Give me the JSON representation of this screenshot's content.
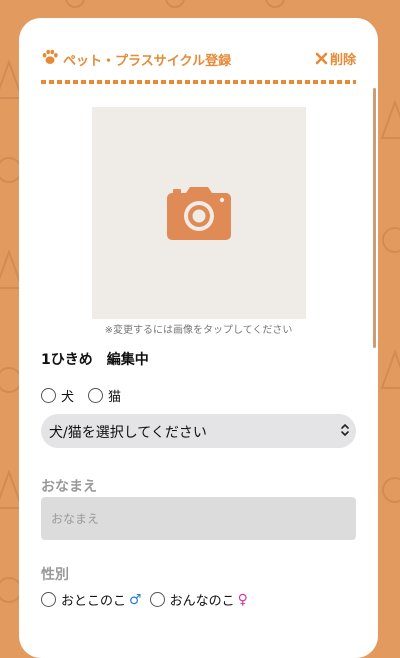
{
  "header": {
    "title": "ペット・プラスサイクル登録",
    "delete_label": "削除"
  },
  "photo": {
    "hint": "※変更するには画像をタップしてください"
  },
  "pet": {
    "editing_label": "1ひきめ　編集中",
    "species_options": [
      "犬",
      "猫"
    ],
    "species_select_value": "犬/猫を選択してください"
  },
  "name": {
    "label": "おなまえ",
    "placeholder": "おなまえ"
  },
  "gender": {
    "label": "性別",
    "options": [
      "おとこのこ",
      "おんなのこ"
    ],
    "male_symbol": "♂",
    "female_symbol": "♀"
  },
  "colors": {
    "background": "#e39a5f",
    "accent": "#e68a35",
    "photo_bg": "#efebe7"
  }
}
